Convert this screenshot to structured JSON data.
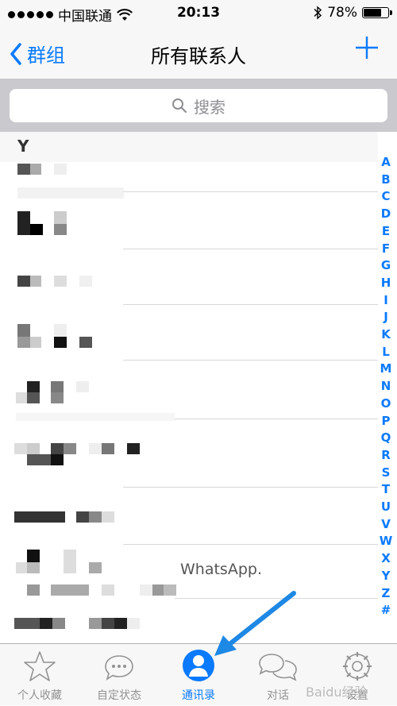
{
  "status": {
    "carrier": "中国联通",
    "time": "20:13",
    "battery_text": "78%",
    "battery_level": 0.78
  },
  "nav": {
    "back_label": "群组",
    "title": "所有联系人",
    "add_icon": "plus-icon"
  },
  "search": {
    "placeholder": "搜索"
  },
  "section": {
    "letter": "Y"
  },
  "list": {
    "note_text": "WhatsApp."
  },
  "index_letters": [
    "A",
    "B",
    "C",
    "D",
    "E",
    "F",
    "G",
    "H",
    "I",
    "J",
    "K",
    "L",
    "M",
    "N",
    "O",
    "P",
    "Q",
    "R",
    "S",
    "T",
    "U",
    "V",
    "W",
    "X",
    "Y",
    "Z",
    "#"
  ],
  "tabs": [
    {
      "label": "个人收藏",
      "icon": "star-icon",
      "active": false
    },
    {
      "label": "自定状态",
      "icon": "chat-bubble-icon",
      "active": false
    },
    {
      "label": "通讯录",
      "icon": "person-icon",
      "active": true
    },
    {
      "label": "对话",
      "icon": "chats-icon",
      "active": false
    },
    {
      "label": "设置",
      "icon": "gear-icon",
      "active": false
    }
  ],
  "colors": {
    "accent": "#0a7aff",
    "tab_inactive": "#929292",
    "arrow": "#1e88e5"
  },
  "watermark": "Baidu经验"
}
